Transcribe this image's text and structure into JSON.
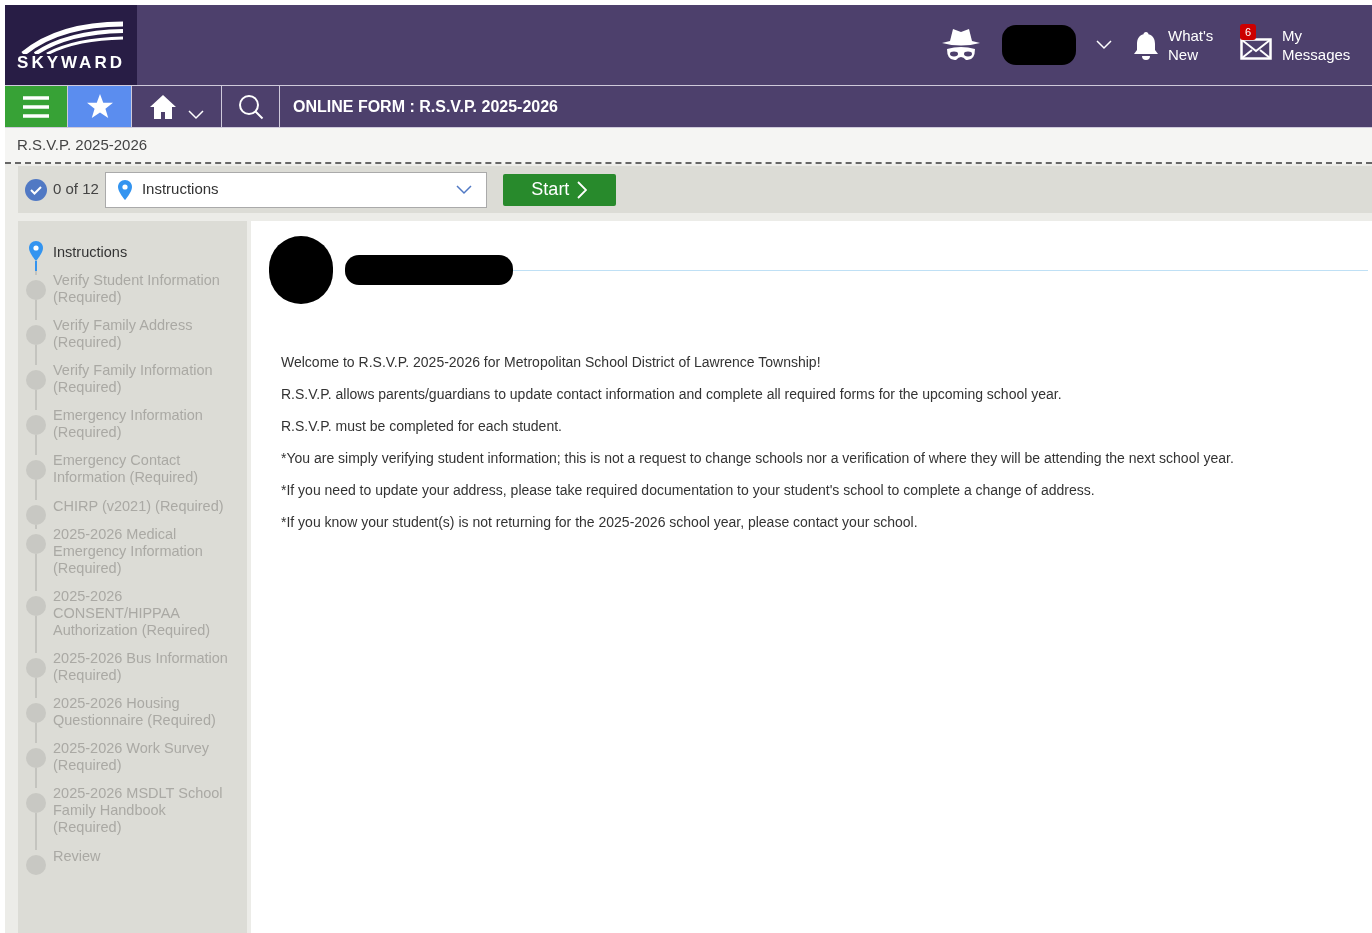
{
  "header": {
    "whats_new": "What's New",
    "messages": {
      "label": "My Messages",
      "badge": "6"
    },
    "logo": "SKYWARD"
  },
  "nav": {
    "title": "ONLINE FORM : R.S.V.P. 2025-2026"
  },
  "breadcrumb": "R.S.V.P. 2025-2026",
  "toolbar": {
    "progress": "0 of 12",
    "step_select": {
      "value": "Instructions"
    },
    "start_button": "Start"
  },
  "steps": [
    {
      "label": "Instructions",
      "selected": true
    },
    {
      "label": "Verify Student Information (Required)",
      "selected": false
    },
    {
      "label": "Verify Family Address (Required)",
      "selected": false
    },
    {
      "label": "Verify Family Information (Required)",
      "selected": false
    },
    {
      "label": "Emergency Information (Required)",
      "selected": false
    },
    {
      "label": "Emergency Contact Information (Required)",
      "selected": false
    },
    {
      "label": "CHIRP (v2021) (Required)",
      "selected": false
    },
    {
      "label": "2025-2026 Medical Emergency Information (Required)",
      "selected": false
    },
    {
      "label": "2025-2026 CONSENT/HIPPAA Authorization (Required)",
      "selected": false
    },
    {
      "label": "2025-2026 Bus Information (Required)",
      "selected": false
    },
    {
      "label": "2025-2026 Housing Questionnaire (Required)",
      "selected": false
    },
    {
      "label": "2025-2026 Work Survey (Required)",
      "selected": false
    },
    {
      "label": "2025-2026 MSDLT School Family Handbook (Required)",
      "selected": false
    },
    {
      "label": "Review",
      "selected": false
    }
  ],
  "content": {
    "paragraphs": [
      "Welcome to R.S.V.P. 2025-2026 for Metropolitan School District of Lawrence Township!",
      "R.S.V.P. allows parents/guardians to update contact information and complete all required forms for the upcoming school year.",
      "R.S.V.P. must be completed for each student.",
      "*You are simply verifying student information; this is not a request to change schools nor a verification of where they will be attending the next school year.",
      "*If you need to update your address, please take required documentation to your student's school to complete a change of address.",
      "*If you know your student(s) is not returning for the 2025-2026 school year, please contact your school."
    ]
  }
}
